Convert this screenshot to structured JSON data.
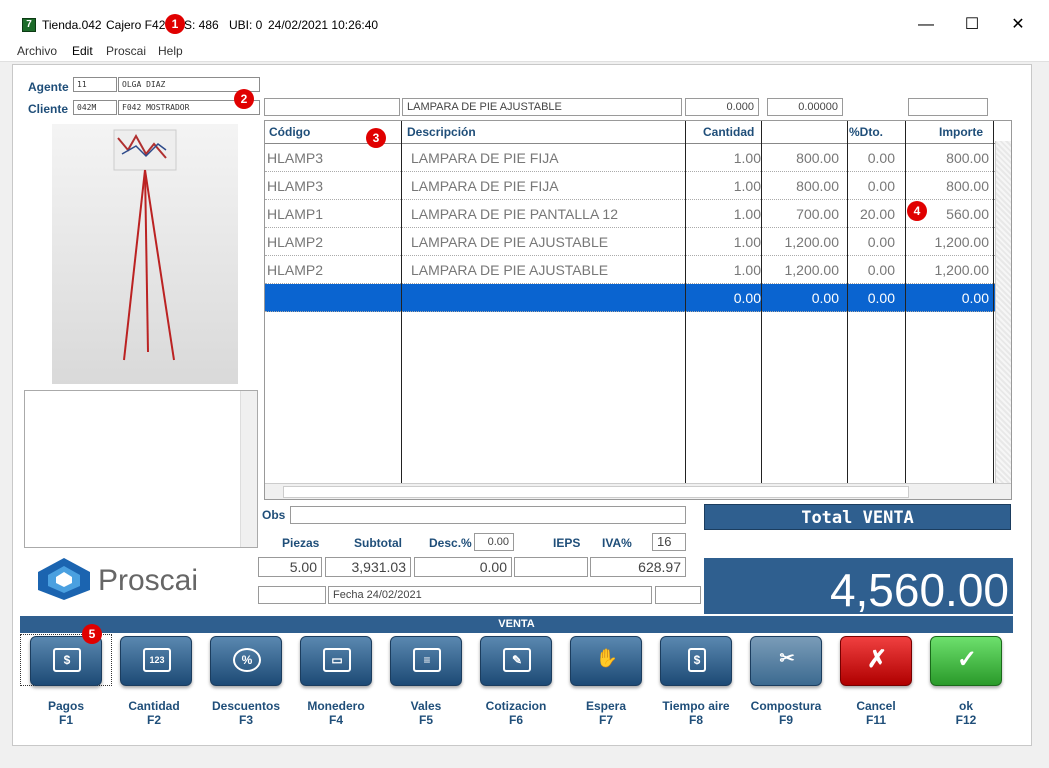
{
  "titlebar": {
    "store": "Tienda.042",
    "cashier": "Cajero F42",
    "es": "ES: 486",
    "ubi": "UBI: 0",
    "datetime": "24/02/2021 10:26:40",
    "minimize": "—",
    "maximize": "☐",
    "close": "✕"
  },
  "menu": [
    "Archivo",
    "Edit",
    "Proscai",
    "Help"
  ],
  "left": {
    "agente_label": "Agente",
    "agente_code": "11",
    "agente_name": "OLGA DIAZ",
    "cliente_label": "Cliente",
    "cliente_code": "042M",
    "cliente_name": "F042 MOSTRADOR",
    "logo_text": "Proscai"
  },
  "entry": {
    "code": "",
    "desc": "LAMPARA DE PIE AJUSTABLE",
    "qty": "0.000",
    "price": "0.00000",
    "extra": ""
  },
  "grid": {
    "headers": {
      "codigo": "Código",
      "descripcion": "Descripción",
      "cantidad": "Cantidad",
      "price": "",
      "dto": "%Dto.",
      "importe": "Importe"
    },
    "rows": [
      {
        "code": "HLAMP3",
        "desc": "LAMPARA DE PIE FIJA",
        "qty": "1.00",
        "price": "800.00",
        "dto": "0.00",
        "imp": "800.00"
      },
      {
        "code": "HLAMP3",
        "desc": "LAMPARA DE PIE FIJA",
        "qty": "1.00",
        "price": "800.00",
        "dto": "0.00",
        "imp": "800.00"
      },
      {
        "code": "HLAMP1",
        "desc": "LAMPARA DE PIE PANTALLA 12",
        "qty": "1.00",
        "price": "700.00",
        "dto": "20.00",
        "imp": "560.00"
      },
      {
        "code": "HLAMP2",
        "desc": "LAMPARA DE PIE AJUSTABLE",
        "qty": "1.00",
        "price": "1,200.00",
        "dto": "0.00",
        "imp": "1,200.00"
      },
      {
        "code": "HLAMP2",
        "desc": "LAMPARA DE PIE AJUSTABLE",
        "qty": "1.00",
        "price": "1,200.00",
        "dto": "0.00",
        "imp": "1,200.00"
      },
      {
        "code": "",
        "desc": "",
        "qty": "0.00",
        "price": "0.00",
        "dto": "0.00",
        "imp": "0.00"
      }
    ]
  },
  "summary": {
    "obs_label": "Obs",
    "obs": "",
    "piezas_label": "Piezas",
    "subtotal_label": "Subtotal",
    "desc_label": "Desc.%",
    "desc_pct": "0.00",
    "ieps_label": "IEPS",
    "iva_label": "IVA%",
    "iva_pct": "16",
    "piezas": "5.00",
    "subtotal": "3,931.03",
    "desc": "0.00",
    "ieps": "",
    "iva": "628.97",
    "fecha": "Fecha 24/02/2021",
    "total_label": "Total VENTA",
    "total": "4,560.00"
  },
  "venta_bar": "VENTA",
  "buttons": [
    {
      "label": "Pagos",
      "key": "F1",
      "icon": "$"
    },
    {
      "label": "Cantidad",
      "key": "F2",
      "icon": "123"
    },
    {
      "label": "Descuentos",
      "key": "F3",
      "icon": "%"
    },
    {
      "label": "Monedero",
      "key": "F4",
      "icon": "▭"
    },
    {
      "label": "Vales",
      "key": "F5",
      "icon": "≡"
    },
    {
      "label": "Cotizacion",
      "key": "F6",
      "icon": "✎"
    },
    {
      "label": "Espera",
      "key": "F7",
      "icon": "✋"
    },
    {
      "label": "Tiempo aire",
      "key": "F8",
      "icon": "$"
    },
    {
      "label": "Compostura",
      "key": "F9",
      "icon": "✂"
    },
    {
      "label": "Cancel",
      "key": "F11",
      "icon": "✗"
    },
    {
      "label": "ok",
      "key": "F12",
      "icon": "✓"
    }
  ],
  "badges": [
    "1",
    "2",
    "3",
    "4",
    "5"
  ]
}
